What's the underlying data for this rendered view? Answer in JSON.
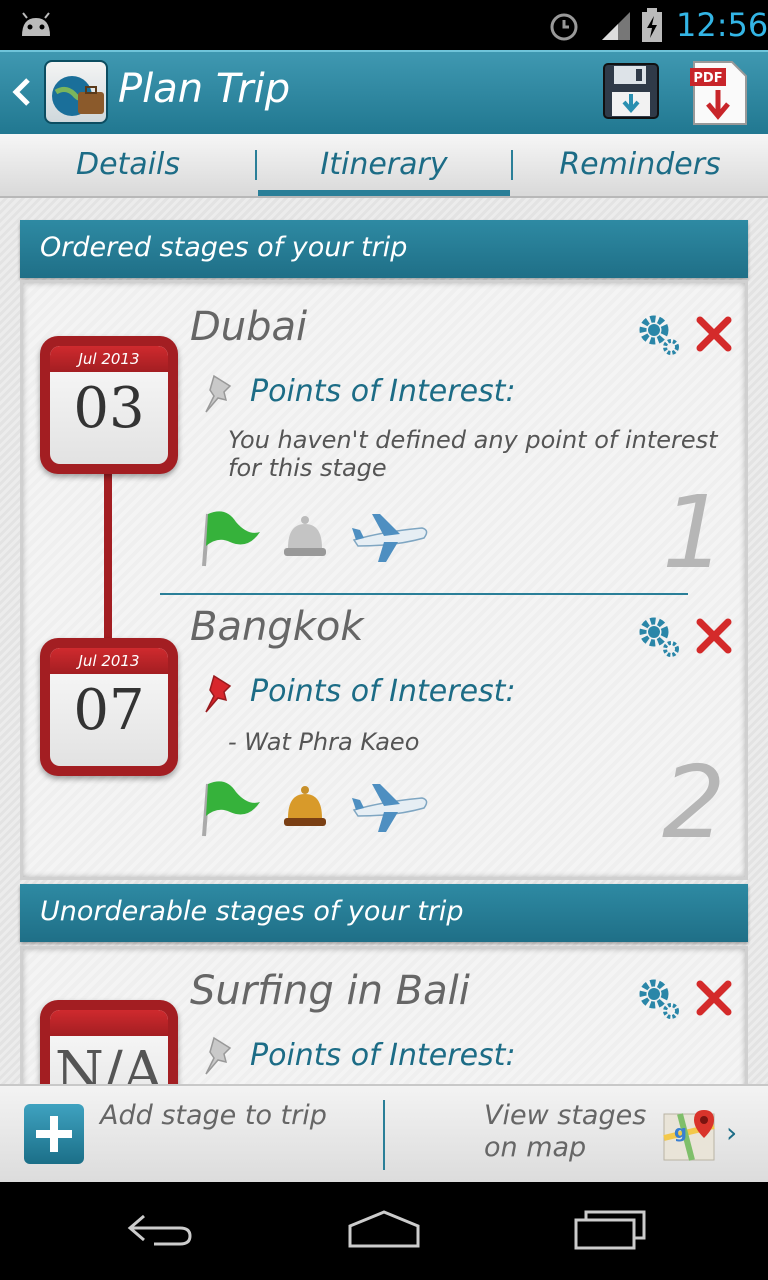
{
  "status_bar": {
    "time": "12:56"
  },
  "action_bar": {
    "title": "Plan Trip"
  },
  "tabs": [
    {
      "label": "Details",
      "active": false
    },
    {
      "label": "Itinerary",
      "active": true
    },
    {
      "label": "Reminders",
      "active": false
    }
  ],
  "ordered_section": {
    "title": "Ordered stages of your trip"
  },
  "stages": [
    {
      "name": "Dubai",
      "month": "Jul 2013",
      "day": "03",
      "poi_label": "Points of Interest:",
      "poi_text": "You haven't defined any point of interest for this stage",
      "order": "1"
    },
    {
      "name": "Bangkok",
      "month": "Jul 2013",
      "day": "07",
      "poi_label": "Points of Interest:",
      "poi_text": "- Wat Phra Kaeo",
      "order": "2"
    }
  ],
  "unordered_section": {
    "title": "Unorderable stages of your trip"
  },
  "unordered_stage": {
    "name": "Surfing in Bali",
    "day": "N/A",
    "poi_label": "Points of Interest:"
  },
  "bottom_bar": {
    "add_label": "Add stage to trip",
    "map_label": "View stages on map"
  },
  "colors": {
    "accent": "#2a7f98",
    "calendar_red": "#a31e22",
    "status_time": "#33b5e5"
  }
}
